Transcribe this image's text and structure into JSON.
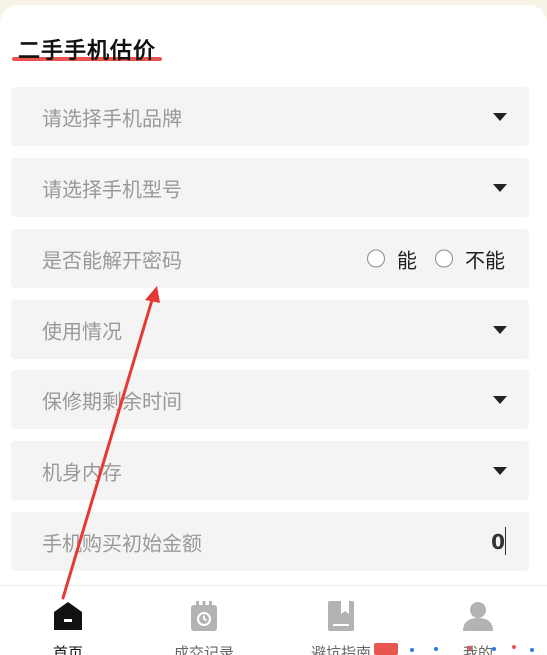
{
  "header": {
    "title": "二手手机估价"
  },
  "form": {
    "brand_placeholder": "请选择手机品牌",
    "model_placeholder": "请选择手机型号",
    "password_label": "是否能解开密码",
    "password_options": [
      "能",
      "不能"
    ],
    "usage_placeholder": "使用情况",
    "warranty_placeholder": "保修期剩余时间",
    "storage_placeholder": "机身内存",
    "price_label": "手机购买初始金额",
    "price_value": "0"
  },
  "tabbar": {
    "items": [
      {
        "label": "首页",
        "icon": "home-icon",
        "active": true
      },
      {
        "label": "成交记录",
        "icon": "calendar-icon",
        "active": false
      },
      {
        "label": "避坑指南",
        "icon": "book-icon",
        "active": false
      },
      {
        "label": "我的",
        "icon": "user-icon",
        "active": false
      }
    ]
  },
  "colors": {
    "accent_underline": "#e8564f",
    "annotation_arrow": "#e53935",
    "field_background": "#f4f4f4",
    "placeholder_text": "#999999"
  }
}
